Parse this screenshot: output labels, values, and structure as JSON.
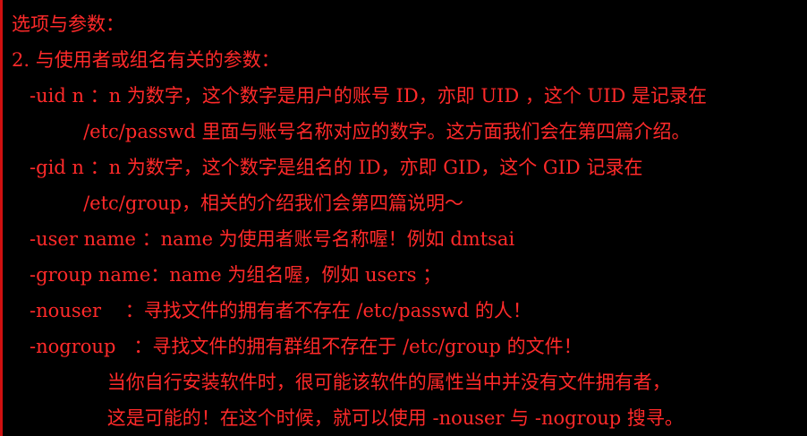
{
  "colors": {
    "background": "#000000",
    "text": "#ff2a2a",
    "left_border": "#d01010"
  },
  "lines": [
    "选项与参数：",
    "2. 与使用者或组名有关的参数：",
    "   -uid n ：n 为数字，这个数字是用户的账号 ID，亦即 UID ，这个 UID 是记录在",
    "            /etc/passwd 里面与账号名称对应的数字。这方面我们会在第四篇介绍。",
    "   -gid n ：n 为数字，这个数字是组名的 ID，亦即 GID，这个 GID 记录在",
    "            /etc/group，相关的介绍我们会第四篇说明～",
    "   -user name ：name 为使用者账号名称喔！例如 dmtsai",
    "   -group name：name 为组名喔，例如 users ；",
    "   -nouser    ：寻找文件的拥有者不存在 /etc/passwd 的人！",
    "   -nogroup   ：寻找文件的拥有群组不存在于 /etc/group 的文件！",
    "                当你自行安装软件时，很可能该软件的属性当中并没有文件拥有者，",
    "                这是可能的！在这个时候，就可以使用 -nouser 与 -nogroup 搜寻。"
  ]
}
